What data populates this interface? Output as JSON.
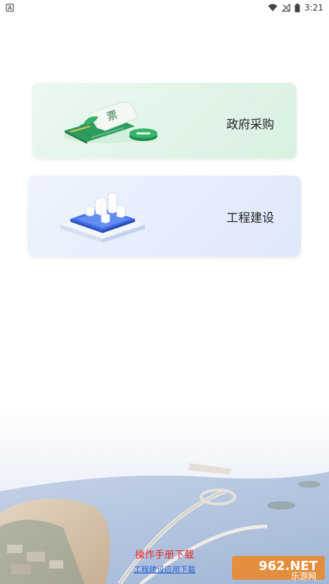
{
  "status_bar": {
    "time": "3:21",
    "icons": [
      "notification-a-icon",
      "wifi-icon",
      "signal-icon",
      "battery-icon"
    ]
  },
  "cards": [
    {
      "label": "政府采购",
      "icon": "bill-cash-icon"
    },
    {
      "label": "工程建设",
      "icon": "building-platform-icon"
    }
  ],
  "bottom": {
    "manual_link": "操作手册下载",
    "app_link": "工程建设应用下载"
  },
  "watermark": {
    "brand": "962.NET",
    "sub": "乐游网"
  },
  "colors": {
    "procure_card_bg": "#dff3e6",
    "build_card_bg": "#e4ecfb",
    "manual_link": "#e5262a",
    "app_link": "#2a5fd0"
  }
}
